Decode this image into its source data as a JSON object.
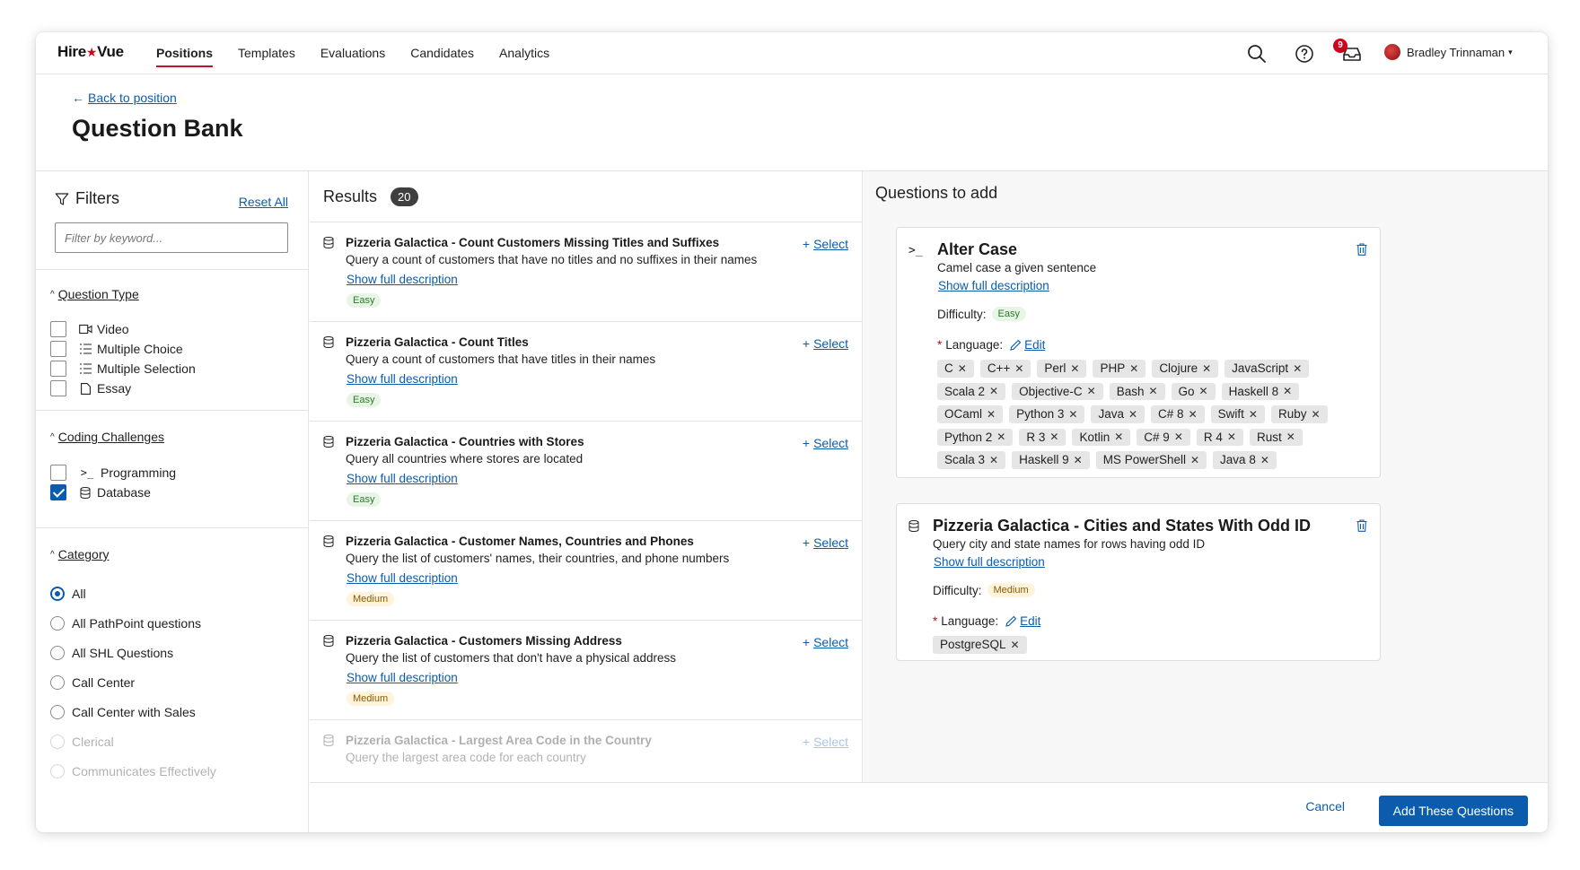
{
  "nav": {
    "logo": "HireVue",
    "links": [
      "Positions",
      "Templates",
      "Evaluations",
      "Candidates",
      "Analytics"
    ],
    "notifications_count": "9",
    "user_name": "Bradley Trinnaman"
  },
  "header": {
    "back_label": "Back to position",
    "title": "Question Bank"
  },
  "filters": {
    "title": "Filters",
    "reset_label": "Reset All",
    "keyword_placeholder": "Filter by keyword...",
    "question_type": {
      "title": "Question Type",
      "options": [
        "Video",
        "Multiple Choice",
        "Multiple Selection",
        "Essay"
      ]
    },
    "coding": {
      "title": "Coding Challenges",
      "options": [
        "Programming",
        "Database"
      ],
      "checked": "Database"
    },
    "category": {
      "title": "Category",
      "options": [
        "All",
        "All PathPoint questions",
        "All SHL Questions",
        "Call Center",
        "Call Center with Sales",
        "Clerical",
        "Communicates Effectively"
      ],
      "selected": "All"
    }
  },
  "results": {
    "title": "Results",
    "count": "20",
    "select_label": "Select",
    "more_label": "Show full description",
    "items": [
      {
        "title": "Pizzeria Galactica - Count Customers Missing Titles and Suffixes",
        "desc": "Query a count of customers that have no titles and no suffixes in their names",
        "difficulty": "Easy"
      },
      {
        "title": "Pizzeria Galactica - Count Titles",
        "desc": "Query a count of customers that have titles in their names",
        "difficulty": "Easy"
      },
      {
        "title": "Pizzeria Galactica - Countries with Stores",
        "desc": "Query all countries where stores are located",
        "difficulty": "Easy"
      },
      {
        "title": "Pizzeria Galactica - Customer Names, Countries and Phones",
        "desc": "Query the list of customers' names, their countries, and phone numbers",
        "difficulty": "Medium"
      },
      {
        "title": "Pizzeria Galactica - Customers Missing Address",
        "desc": "Query the list of customers that don't have a physical address",
        "difficulty": "Medium"
      },
      {
        "title": "Pizzeria Galactica - Largest Area Code in the Country",
        "desc": "Query the largest area code for each country",
        "difficulty": ""
      }
    ]
  },
  "to_add": {
    "title": "Questions to add",
    "difficulty_label": "Difficulty:",
    "language_label": "Language:",
    "edit_label": "Edit",
    "more_label": "Show full description",
    "cards": [
      {
        "title": "Alter Case",
        "desc": "Camel case a given sentence",
        "difficulty": "Easy",
        "icon": "terminal-icon",
        "languages": [
          "C",
          "C++",
          "Perl",
          "PHP",
          "Clojure",
          "JavaScript",
          "Scala 2",
          "Objective-C",
          "Bash",
          "Go",
          "Haskell 8",
          "OCaml",
          "Python 3",
          "Java",
          "C# 8",
          "Swift",
          "Ruby",
          "Python 2",
          "R 3",
          "Kotlin",
          "C# 9",
          "R 4",
          "Rust",
          "Scala 3",
          "Haskell 9",
          "MS PowerShell",
          "Java 8"
        ]
      },
      {
        "title": "Pizzeria Galactica - Cities and States With Odd ID",
        "desc": "Query city and state names for rows having odd ID",
        "difficulty": "Medium",
        "icon": "database-icon",
        "languages": [
          "PostgreSQL"
        ]
      }
    ]
  },
  "footer": {
    "cancel_label": "Cancel",
    "add_label": "Add These Questions"
  },
  "colors": {
    "accent": "#0b5cad",
    "brand_red": "#c8102e"
  }
}
